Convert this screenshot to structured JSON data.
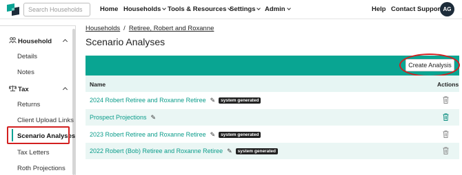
{
  "header": {
    "search_placeholder": "Search Households",
    "nav_left": [
      "Home",
      "Households",
      "Tools & Resources",
      "Settings",
      "Admin"
    ],
    "nav_right": [
      "Help",
      "Contact Support"
    ],
    "avatar_initials": "AG"
  },
  "sidebar": {
    "household_label": "Household",
    "household_items": [
      "Details",
      "Notes"
    ],
    "tax_label": "Tax",
    "tax_items": [
      "Returns",
      "Client Upload Links",
      "Scenario Analyses",
      "Tax Letters",
      "Roth Projections"
    ],
    "active_item": "Scenario Analyses"
  },
  "breadcrumb": {
    "root": "Households",
    "separator": "/",
    "current": "Retiree, Robert and Roxanne"
  },
  "page_title": "Scenario Analyses",
  "create_button_label": "Create Analysis",
  "table": {
    "col_name": "Name",
    "col_actions": "Actions",
    "rows": [
      {
        "name": "2024 Robert Retiree and Roxanne Retiree",
        "badge": "system generated",
        "trash_color": "#8a8a8a"
      },
      {
        "name": "Prospect Projections",
        "badge": "",
        "trash_color": "#0a8d7f"
      },
      {
        "name": "2023 Robert Retiree and Roxanne Retiree",
        "badge": "system generated",
        "trash_color": "#8a8a8a"
      },
      {
        "name": "2022 Robert (Bob) Retiree and Roxanne Retiree",
        "badge": "system generated",
        "trash_color": "#8a8a8a"
      }
    ]
  },
  "colors": {
    "accent": "#09a592",
    "link": "#0a9c8a",
    "highlight": "#d21f1f"
  }
}
